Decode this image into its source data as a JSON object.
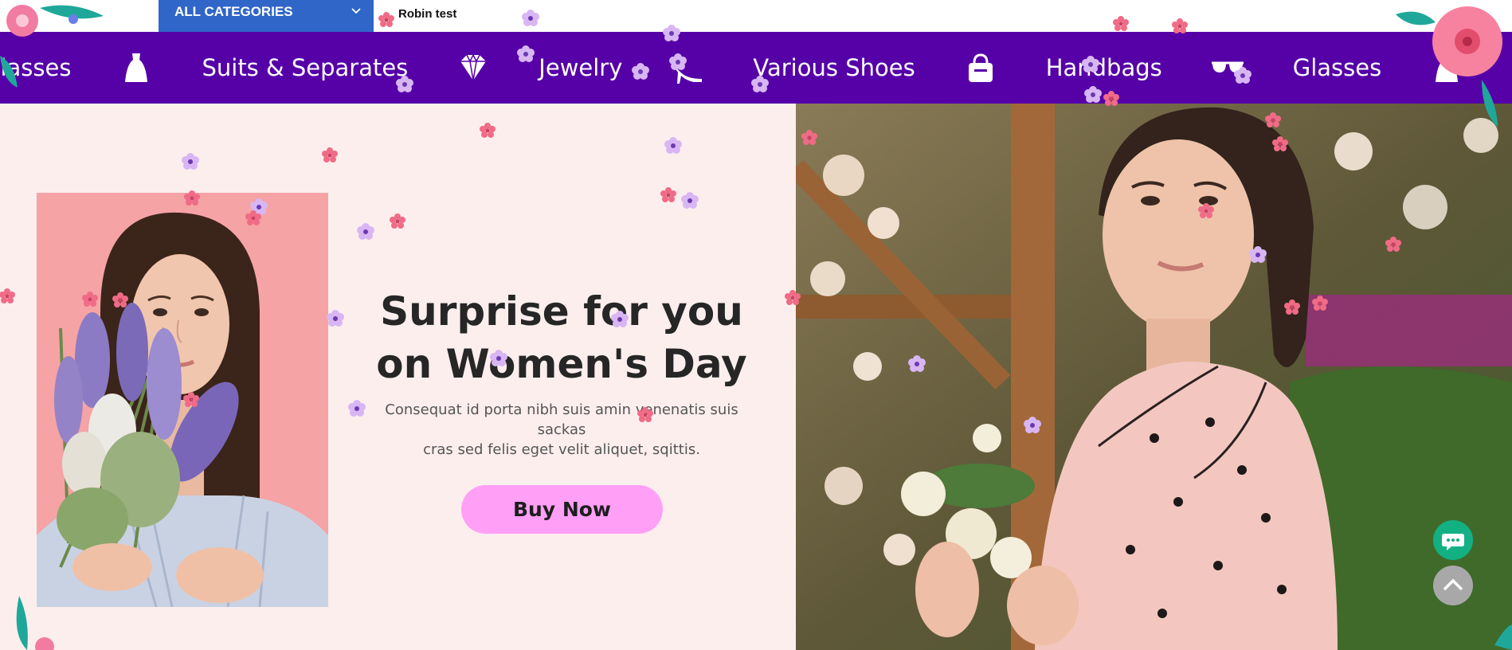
{
  "topbar": {
    "category_label": "ALL CATEGORIES",
    "search_value": "Robin test"
  },
  "categories": [
    {
      "label": "Glasses",
      "icon": "sunglasses-icon"
    },
    {
      "label": "Suits & Separates",
      "icon": "dress-icon"
    },
    {
      "label": "Jewelry",
      "icon": "diamond-icon"
    },
    {
      "label": "Various Shoes",
      "icon": "high-heel-icon"
    },
    {
      "label": "Handbags",
      "icon": "handbag-icon"
    },
    {
      "label": "Glasses",
      "icon": "sunglasses-icon"
    }
  ],
  "hero": {
    "headline_line1": "Surprise for you",
    "headline_line2": "on Women's Day",
    "subtext_line1": "Consequat id porta nibh suis amin venenatis suis sackas",
    "subtext_line2": "cras sed felis eget velit aliquet, sqittis.",
    "button_label": "Buy Now"
  },
  "colors": {
    "category_bar": "#5600a8",
    "category_select": "#2f66c8",
    "hero_bg": "#fdeeee",
    "button": "#ff9ff5",
    "chat_button": "#13b083",
    "scroll_top_button": "#a8a8a8"
  },
  "icons": {
    "chat": "chat-bubble-icon",
    "scroll_top": "chevron-up-icon",
    "dropdown": "chevron-down-icon"
  }
}
